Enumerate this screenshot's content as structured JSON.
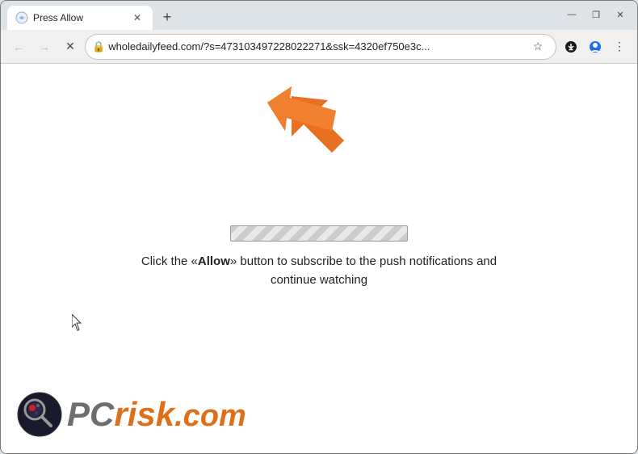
{
  "window": {
    "title": "Press Allow",
    "controls": {
      "minimize": "—",
      "maximize": "❐",
      "close": "✕"
    }
  },
  "tab": {
    "favicon_alt": "page icon",
    "title": "Press Allow",
    "close_label": "✕"
  },
  "new_tab_btn": "+",
  "toolbar": {
    "back_label": "←",
    "forward_label": "→",
    "reload_label": "✕",
    "url": "wholedailyfeed.com/?s=473103497228022271&ssk=4320ef750e3c...",
    "bookmark_label": "☆",
    "profile_label": "👤",
    "menu_label": "⋮"
  },
  "page": {
    "instruction_text": "Click the «Allow» button to subscribe to the push notifications and continue watching",
    "instruction_allow": "Allow"
  },
  "footer": {
    "pc_text": "PC",
    "risk_text": "risk",
    "com_text": ".com"
  }
}
